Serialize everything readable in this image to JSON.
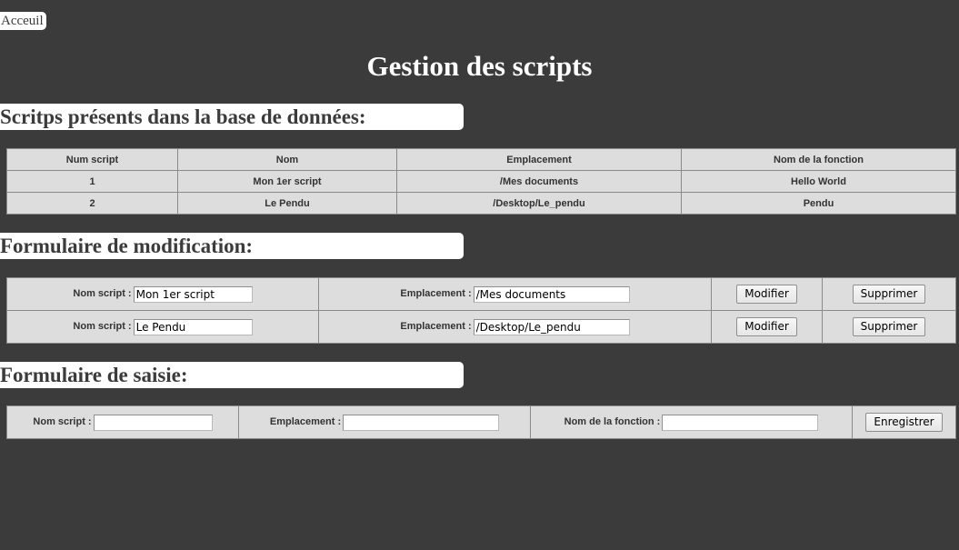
{
  "nav": {
    "home_label": "Acceuil"
  },
  "page": {
    "title": "Gestion des scripts"
  },
  "section_existing": {
    "heading": "Scritps présents dans la base de données:",
    "columns": [
      "Num script",
      "Nom",
      "Emplacement",
      "Nom de la fonction"
    ],
    "rows": [
      [
        "1",
        "Mon 1er script",
        "/Mes documents",
        "Hello World"
      ],
      [
        "2",
        "Le Pendu",
        "/Desktop/Le_pendu",
        "Pendu"
      ]
    ]
  },
  "section_edit": {
    "heading": "Formulaire de modification:",
    "name_label": "Nom script :",
    "location_label": "Emplacement :",
    "modify_label": "Modifier",
    "delete_label": "Supprimer",
    "rows": [
      {
        "name_value": "Mon 1er script",
        "location_value": "/Mes documents"
      },
      {
        "name_value": "Le Pendu",
        "location_value": "/Desktop/Le_pendu"
      }
    ]
  },
  "section_new": {
    "heading": "Formulaire de saisie:",
    "name_label": "Nom script :",
    "location_label": "Emplacement :",
    "function_label": "Nom de la fonction :",
    "name_value": "",
    "location_value": "",
    "function_value": "",
    "save_label": "Enregistrer"
  },
  "colors": {
    "background": "#3b3b3b",
    "table_bg": "#dddddd",
    "heading_bg": "#ffffff"
  }
}
